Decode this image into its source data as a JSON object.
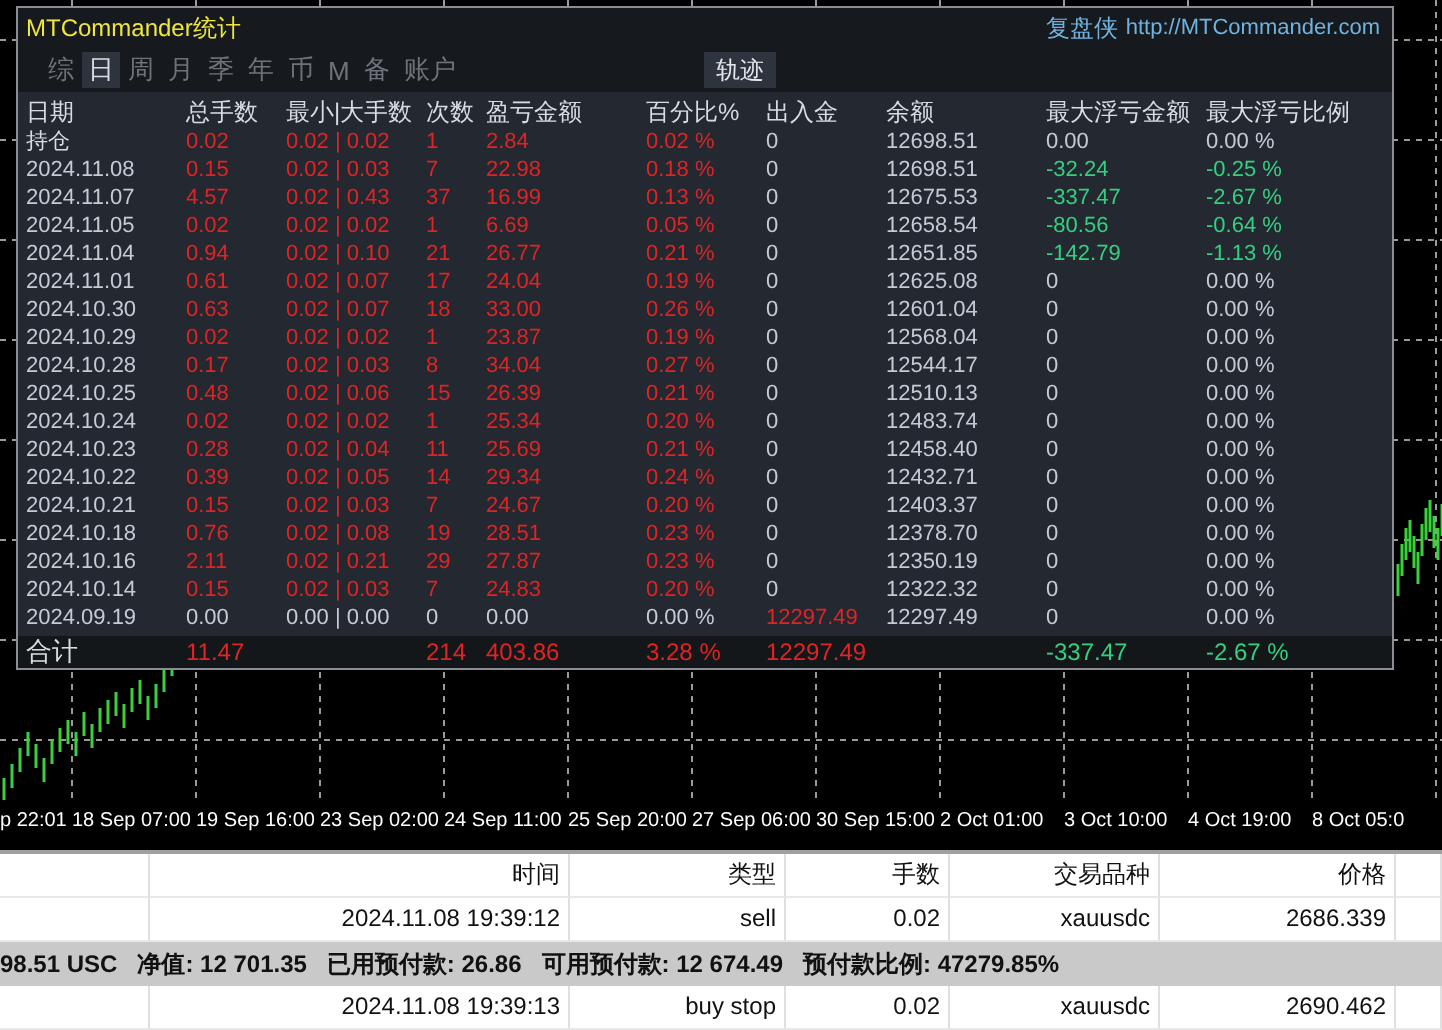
{
  "window": {
    "title": "MTCommander统计",
    "brand": "复盘侠",
    "url": "http://MTCommander.com"
  },
  "tabs": [
    {
      "label": "综",
      "selected": false
    },
    {
      "label": "日",
      "selected": true
    },
    {
      "label": "周",
      "selected": false
    },
    {
      "label": "月",
      "selected": false
    },
    {
      "label": "季",
      "selected": false
    },
    {
      "label": "年",
      "selected": false
    },
    {
      "label": "币",
      "selected": false
    },
    {
      "label": "M",
      "selected": false
    },
    {
      "label": "备",
      "selected": false
    },
    {
      "label": "账户",
      "selected": false
    }
  ],
  "track_button": {
    "label": "轨迹"
  },
  "stats_table": {
    "columns": [
      "日期",
      "总手数",
      "最小|大手数",
      "次数",
      "盈亏金额",
      "百分比%",
      "出入金",
      "余额",
      "最大浮亏金额",
      "最大浮亏比例"
    ],
    "rows": [
      {
        "cells": [
          {
            "text": "持仓",
            "color": "#d8dce2"
          },
          {
            "text": "0.02",
            "color": "#e02424"
          },
          {
            "text": "0.02 | 0.02",
            "color": "#e02424"
          },
          {
            "text": "1",
            "color": "#e02424"
          },
          {
            "text": "2.84",
            "color": "#e02424"
          },
          {
            "text": "0.02 %",
            "color": "#e02424"
          },
          {
            "text": "0",
            "color": "#c5cad3"
          },
          {
            "text": "12698.51",
            "color": "#c5cad3"
          },
          {
            "text": "0.00",
            "color": "#c5cad3"
          },
          {
            "text": "0.00 %",
            "color": "#c5cad3"
          }
        ]
      },
      {
        "cells": [
          {
            "text": "2024.11.08",
            "color": "#c5cad3"
          },
          {
            "text": "0.15",
            "color": "#e02424"
          },
          {
            "text": "0.02 | 0.03",
            "color": "#e02424"
          },
          {
            "text": "7",
            "color": "#e02424"
          },
          {
            "text": "22.98",
            "color": "#e02424"
          },
          {
            "text": "0.18 %",
            "color": "#e02424"
          },
          {
            "text": "0",
            "color": "#c5cad3"
          },
          {
            "text": "12698.51",
            "color": "#c5cad3"
          },
          {
            "text": "-32.24",
            "color": "#35d07f"
          },
          {
            "text": "-0.25 %",
            "color": "#35d07f"
          }
        ]
      },
      {
        "cells": [
          {
            "text": "2024.11.07",
            "color": "#c5cad3"
          },
          {
            "text": "4.57",
            "color": "#e02424"
          },
          {
            "text": "0.02 | 0.43",
            "color": "#e02424"
          },
          {
            "text": "37",
            "color": "#e02424"
          },
          {
            "text": "16.99",
            "color": "#e02424"
          },
          {
            "text": "0.13 %",
            "color": "#e02424"
          },
          {
            "text": "0",
            "color": "#c5cad3"
          },
          {
            "text": "12675.53",
            "color": "#c5cad3"
          },
          {
            "text": "-337.47",
            "color": "#35d07f"
          },
          {
            "text": "-2.67 %",
            "color": "#35d07f"
          }
        ]
      },
      {
        "cells": [
          {
            "text": "2024.11.05",
            "color": "#c5cad3"
          },
          {
            "text": "0.02",
            "color": "#e02424"
          },
          {
            "text": "0.02 | 0.02",
            "color": "#e02424"
          },
          {
            "text": "1",
            "color": "#e02424"
          },
          {
            "text": "6.69",
            "color": "#e02424"
          },
          {
            "text": "0.05 %",
            "color": "#e02424"
          },
          {
            "text": "0",
            "color": "#c5cad3"
          },
          {
            "text": "12658.54",
            "color": "#c5cad3"
          },
          {
            "text": "-80.56",
            "color": "#35d07f"
          },
          {
            "text": "-0.64 %",
            "color": "#35d07f"
          }
        ]
      },
      {
        "cells": [
          {
            "text": "2024.11.04",
            "color": "#c5cad3"
          },
          {
            "text": "0.94",
            "color": "#e02424"
          },
          {
            "text": "0.02 | 0.10",
            "color": "#e02424"
          },
          {
            "text": "21",
            "color": "#e02424"
          },
          {
            "text": "26.77",
            "color": "#e02424"
          },
          {
            "text": "0.21 %",
            "color": "#e02424"
          },
          {
            "text": "0",
            "color": "#c5cad3"
          },
          {
            "text": "12651.85",
            "color": "#c5cad3"
          },
          {
            "text": "-142.79",
            "color": "#35d07f"
          },
          {
            "text": "-1.13 %",
            "color": "#35d07f"
          }
        ]
      },
      {
        "cells": [
          {
            "text": "2024.11.01",
            "color": "#c5cad3"
          },
          {
            "text": "0.61",
            "color": "#e02424"
          },
          {
            "text": "0.02 | 0.07",
            "color": "#e02424"
          },
          {
            "text": "17",
            "color": "#e02424"
          },
          {
            "text": "24.04",
            "color": "#e02424"
          },
          {
            "text": "0.19 %",
            "color": "#e02424"
          },
          {
            "text": "0",
            "color": "#c5cad3"
          },
          {
            "text": "12625.08",
            "color": "#c5cad3"
          },
          {
            "text": "0",
            "color": "#c5cad3"
          },
          {
            "text": "0.00 %",
            "color": "#c5cad3"
          }
        ]
      },
      {
        "cells": [
          {
            "text": "2024.10.30",
            "color": "#c5cad3"
          },
          {
            "text": "0.63",
            "color": "#e02424"
          },
          {
            "text": "0.02 | 0.07",
            "color": "#e02424"
          },
          {
            "text": "18",
            "color": "#e02424"
          },
          {
            "text": "33.00",
            "color": "#e02424"
          },
          {
            "text": "0.26 %",
            "color": "#e02424"
          },
          {
            "text": "0",
            "color": "#c5cad3"
          },
          {
            "text": "12601.04",
            "color": "#c5cad3"
          },
          {
            "text": "0",
            "color": "#c5cad3"
          },
          {
            "text": "0.00 %",
            "color": "#c5cad3"
          }
        ]
      },
      {
        "cells": [
          {
            "text": "2024.10.29",
            "color": "#c5cad3"
          },
          {
            "text": "0.02",
            "color": "#e02424"
          },
          {
            "text": "0.02 | 0.02",
            "color": "#e02424"
          },
          {
            "text": "1",
            "color": "#e02424"
          },
          {
            "text": "23.87",
            "color": "#e02424"
          },
          {
            "text": "0.19 %",
            "color": "#e02424"
          },
          {
            "text": "0",
            "color": "#c5cad3"
          },
          {
            "text": "12568.04",
            "color": "#c5cad3"
          },
          {
            "text": "0",
            "color": "#c5cad3"
          },
          {
            "text": "0.00 %",
            "color": "#c5cad3"
          }
        ]
      },
      {
        "cells": [
          {
            "text": "2024.10.28",
            "color": "#c5cad3"
          },
          {
            "text": "0.17",
            "color": "#e02424"
          },
          {
            "text": "0.02 | 0.03",
            "color": "#e02424"
          },
          {
            "text": "8",
            "color": "#e02424"
          },
          {
            "text": "34.04",
            "color": "#e02424"
          },
          {
            "text": "0.27 %",
            "color": "#e02424"
          },
          {
            "text": "0",
            "color": "#c5cad3"
          },
          {
            "text": "12544.17",
            "color": "#c5cad3"
          },
          {
            "text": "0",
            "color": "#c5cad3"
          },
          {
            "text": "0.00 %",
            "color": "#c5cad3"
          }
        ]
      },
      {
        "cells": [
          {
            "text": "2024.10.25",
            "color": "#c5cad3"
          },
          {
            "text": "0.48",
            "color": "#e02424"
          },
          {
            "text": "0.02 | 0.06",
            "color": "#e02424"
          },
          {
            "text": "15",
            "color": "#e02424"
          },
          {
            "text": "26.39",
            "color": "#e02424"
          },
          {
            "text": "0.21 %",
            "color": "#e02424"
          },
          {
            "text": "0",
            "color": "#c5cad3"
          },
          {
            "text": "12510.13",
            "color": "#c5cad3"
          },
          {
            "text": "0",
            "color": "#c5cad3"
          },
          {
            "text": "0.00 %",
            "color": "#c5cad3"
          }
        ]
      },
      {
        "cells": [
          {
            "text": "2024.10.24",
            "color": "#c5cad3"
          },
          {
            "text": "0.02",
            "color": "#e02424"
          },
          {
            "text": "0.02 | 0.02",
            "color": "#e02424"
          },
          {
            "text": "1",
            "color": "#e02424"
          },
          {
            "text": "25.34",
            "color": "#e02424"
          },
          {
            "text": "0.20 %",
            "color": "#e02424"
          },
          {
            "text": "0",
            "color": "#c5cad3"
          },
          {
            "text": "12483.74",
            "color": "#c5cad3"
          },
          {
            "text": "0",
            "color": "#c5cad3"
          },
          {
            "text": "0.00 %",
            "color": "#c5cad3"
          }
        ]
      },
      {
        "cells": [
          {
            "text": "2024.10.23",
            "color": "#c5cad3"
          },
          {
            "text": "0.28",
            "color": "#e02424"
          },
          {
            "text": "0.02 | 0.04",
            "color": "#e02424"
          },
          {
            "text": "11",
            "color": "#e02424"
          },
          {
            "text": "25.69",
            "color": "#e02424"
          },
          {
            "text": "0.21 %",
            "color": "#e02424"
          },
          {
            "text": "0",
            "color": "#c5cad3"
          },
          {
            "text": "12458.40",
            "color": "#c5cad3"
          },
          {
            "text": "0",
            "color": "#c5cad3"
          },
          {
            "text": "0.00 %",
            "color": "#c5cad3"
          }
        ]
      },
      {
        "cells": [
          {
            "text": "2024.10.22",
            "color": "#c5cad3"
          },
          {
            "text": "0.39",
            "color": "#e02424"
          },
          {
            "text": "0.02 | 0.05",
            "color": "#e02424"
          },
          {
            "text": "14",
            "color": "#e02424"
          },
          {
            "text": "29.34",
            "color": "#e02424"
          },
          {
            "text": "0.24 %",
            "color": "#e02424"
          },
          {
            "text": "0",
            "color": "#c5cad3"
          },
          {
            "text": "12432.71",
            "color": "#c5cad3"
          },
          {
            "text": "0",
            "color": "#c5cad3"
          },
          {
            "text": "0.00 %",
            "color": "#c5cad3"
          }
        ]
      },
      {
        "cells": [
          {
            "text": "2024.10.21",
            "color": "#c5cad3"
          },
          {
            "text": "0.15",
            "color": "#e02424"
          },
          {
            "text": "0.02 | 0.03",
            "color": "#e02424"
          },
          {
            "text": "7",
            "color": "#e02424"
          },
          {
            "text": "24.67",
            "color": "#e02424"
          },
          {
            "text": "0.20 %",
            "color": "#e02424"
          },
          {
            "text": "0",
            "color": "#c5cad3"
          },
          {
            "text": "12403.37",
            "color": "#c5cad3"
          },
          {
            "text": "0",
            "color": "#c5cad3"
          },
          {
            "text": "0.00 %",
            "color": "#c5cad3"
          }
        ]
      },
      {
        "cells": [
          {
            "text": "2024.10.18",
            "color": "#c5cad3"
          },
          {
            "text": "0.76",
            "color": "#e02424"
          },
          {
            "text": "0.02 | 0.08",
            "color": "#e02424"
          },
          {
            "text": "19",
            "color": "#e02424"
          },
          {
            "text": "28.51",
            "color": "#e02424"
          },
          {
            "text": "0.23 %",
            "color": "#e02424"
          },
          {
            "text": "0",
            "color": "#c5cad3"
          },
          {
            "text": "12378.70",
            "color": "#c5cad3"
          },
          {
            "text": "0",
            "color": "#c5cad3"
          },
          {
            "text": "0.00 %",
            "color": "#c5cad3"
          }
        ]
      },
      {
        "cells": [
          {
            "text": "2024.10.16",
            "color": "#c5cad3"
          },
          {
            "text": "2.11",
            "color": "#e02424"
          },
          {
            "text": "0.02 | 0.21",
            "color": "#e02424"
          },
          {
            "text": "29",
            "color": "#e02424"
          },
          {
            "text": "27.87",
            "color": "#e02424"
          },
          {
            "text": "0.23 %",
            "color": "#e02424"
          },
          {
            "text": "0",
            "color": "#c5cad3"
          },
          {
            "text": "12350.19",
            "color": "#c5cad3"
          },
          {
            "text": "0",
            "color": "#c5cad3"
          },
          {
            "text": "0.00 %",
            "color": "#c5cad3"
          }
        ]
      },
      {
        "cells": [
          {
            "text": "2024.10.14",
            "color": "#c5cad3"
          },
          {
            "text": "0.15",
            "color": "#e02424"
          },
          {
            "text": "0.02 | 0.03",
            "color": "#e02424"
          },
          {
            "text": "7",
            "color": "#e02424"
          },
          {
            "text": "24.83",
            "color": "#e02424"
          },
          {
            "text": "0.20 %",
            "color": "#e02424"
          },
          {
            "text": "0",
            "color": "#c5cad3"
          },
          {
            "text": "12322.32",
            "color": "#c5cad3"
          },
          {
            "text": "0",
            "color": "#c5cad3"
          },
          {
            "text": "0.00 %",
            "color": "#c5cad3"
          }
        ]
      },
      {
        "cells": [
          {
            "text": "2024.09.19",
            "color": "#c5cad3"
          },
          {
            "text": "0.00",
            "color": "#c5cad3"
          },
          {
            "text": "0.00 | 0.00",
            "color": "#c5cad3"
          },
          {
            "text": "0",
            "color": "#c5cad3"
          },
          {
            "text": "0.00",
            "color": "#c5cad3"
          },
          {
            "text": "0.00 %",
            "color": "#c5cad3"
          },
          {
            "text": "12297.49",
            "color": "#e02424"
          },
          {
            "text": "12297.49",
            "color": "#c5cad3"
          },
          {
            "text": "0",
            "color": "#c5cad3"
          },
          {
            "text": "0.00 %",
            "color": "#c5cad3"
          }
        ]
      }
    ],
    "total": {
      "cells": [
        {
          "text": "合计",
          "color": "#d8dce2"
        },
        {
          "text": "11.47",
          "color": "#e02424"
        },
        null,
        {
          "text": "214",
          "color": "#e02424"
        },
        {
          "text": "403.86",
          "color": "#e02424"
        },
        {
          "text": "3.28 %",
          "color": "#e02424"
        },
        {
          "text": "12297.49",
          "color": "#e02424"
        },
        null,
        {
          "text": "-337.47",
          "color": "#35d07f"
        },
        {
          "text": "-2.67 %",
          "color": "#35d07f"
        }
      ]
    }
  },
  "time_axis": {
    "labels": [
      "p 22:01",
      "18 Sep 07:00",
      "19 Sep 16:00",
      "23 Sep 02:00",
      "24 Sep 11:00",
      "25 Sep 20:00",
      "27 Sep 06:00",
      "30 Sep 15:00",
      "2 Oct 01:00",
      "3 Oct 10:00",
      "4 Oct 19:00",
      "8 Oct 05:0"
    ]
  },
  "orders_table": {
    "columns": [
      "时间",
      "类型",
      "手数",
      "交易品种",
      "价格"
    ],
    "rows": [
      {
        "kind": "order",
        "time": "2024.11.08 19:39:12",
        "type": "sell",
        "lots": "0.02",
        "symbol": "xauusdc",
        "price": "2686.339"
      },
      {
        "kind": "account",
        "items": [
          "98.51 USC",
          "净值: 12 701.35",
          "已用预付款: 26.86",
          "可用预付款: 12 674.49",
          "预付款比例: 47279.85%"
        ]
      },
      {
        "kind": "order",
        "time": "2024.11.08 19:39:13",
        "type": "buy stop",
        "lots": "0.02",
        "symbol": "xauusdc",
        "price": "2690.462"
      }
    ]
  }
}
